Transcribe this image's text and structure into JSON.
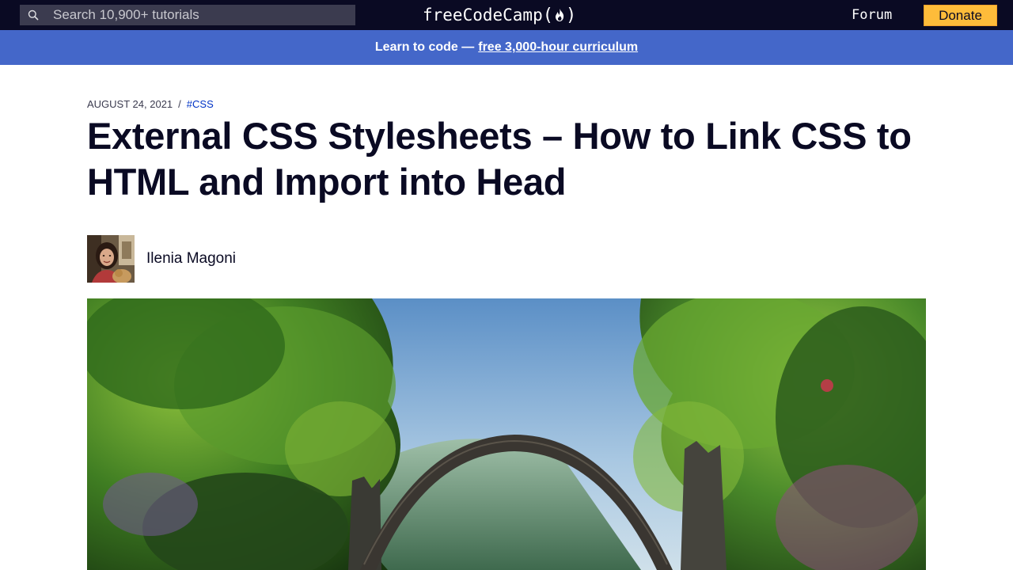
{
  "nav": {
    "search_placeholder": "Search 10,900+ tutorials",
    "logo_text": "freeCodeCamp",
    "logo_open": "(",
    "logo_close": ")",
    "forum_label": "Forum",
    "donate_label": "Donate"
  },
  "banner": {
    "prefix": "Learn to code —",
    "link_text": "free 3,000-hour curriculum"
  },
  "article": {
    "date": "August 24, 2021",
    "separator": "/",
    "tag": "#CSS",
    "title": "External CSS Stylesheets – How to Link CSS to HTML and Import into Head",
    "author": "Ilenia Magoni"
  },
  "icons": {
    "search": "search-icon",
    "flame": "flame-icon"
  },
  "colors": {
    "nav_bg": "#0a0a23",
    "banner_bg": "#4467c9",
    "donate_bg": "#febc3a",
    "tag_link": "#0033c6"
  }
}
